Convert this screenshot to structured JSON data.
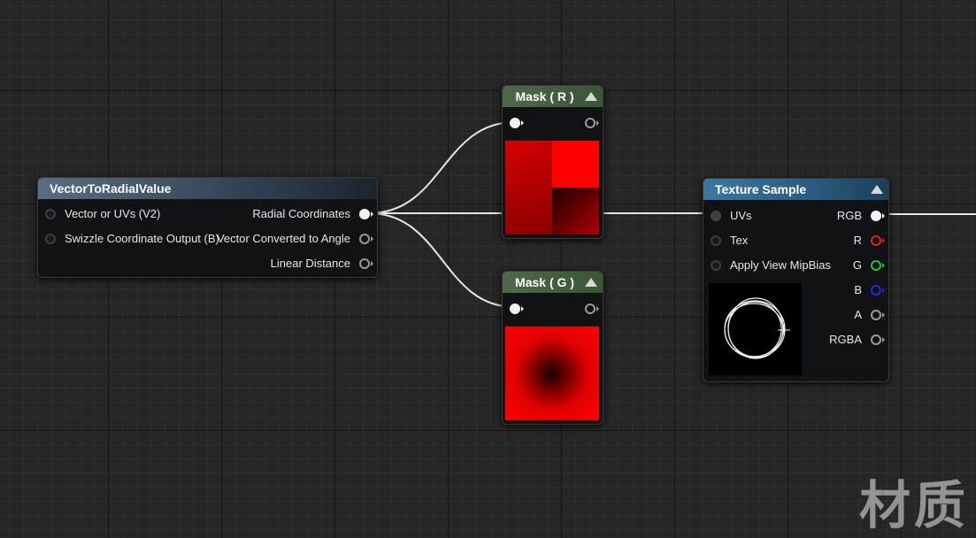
{
  "nodes": {
    "vector_to_radial": {
      "title": "VectorToRadialValue",
      "inputs": [
        "Vector or UVs (V2)",
        "Swizzle Coordinate Output (B)"
      ],
      "outputs": [
        "Radial Coordinates",
        "Vector Converted to Angle",
        "Linear Distance"
      ]
    },
    "mask_r": {
      "title": "Mask ( R )"
    },
    "mask_g": {
      "title": "Mask ( G )"
    },
    "texture_sample": {
      "title": "Texture Sample",
      "inputs": [
        "UVs",
        "Tex",
        "Apply View MipBias"
      ],
      "outputs": [
        "RGB",
        "R",
        "G",
        "B",
        "A",
        "RGBA"
      ]
    }
  },
  "colors": {
    "pin_white": "#f2f2f2",
    "pin_red": "#e0212c",
    "pin_green": "#22c33a",
    "pin_blue": "#1f2bd8",
    "pin_grey": "#9a9a9a",
    "wire": "#e6e6e6",
    "preview_red": "#ff0000"
  },
  "icons": [
    "collapse-arrow-icon",
    "pin-icon"
  ],
  "watermark": "材质"
}
